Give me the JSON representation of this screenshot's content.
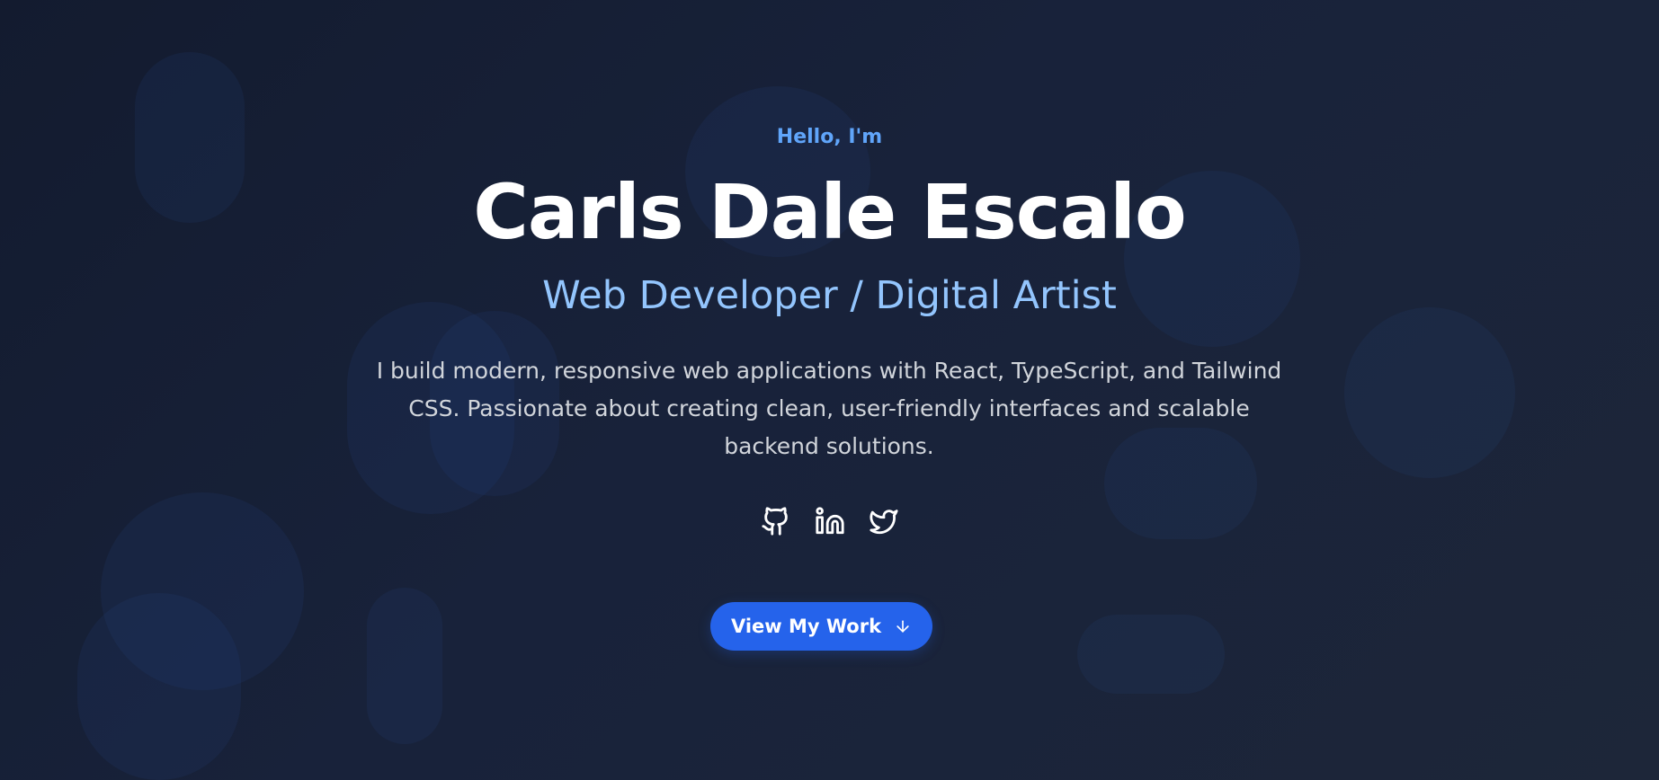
{
  "hero": {
    "greeting": "Hello, I'm",
    "name": "Carls Dale Escalo",
    "role": "Web Developer / Digital Artist",
    "bio": "I build modern, responsive web applications with React, TypeScript, and Tailwind CSS. Passionate about creating clean, user-friendly interfaces and scalable backend solutions."
  },
  "socials": [
    {
      "icon": "github-icon"
    },
    {
      "icon": "linkedin-icon"
    },
    {
      "icon": "twitter-icon"
    }
  ],
  "cta": {
    "label": "View My Work",
    "icon": "arrow-down-icon"
  },
  "colors": {
    "accent": "#60a5fa",
    "role_text": "#93c5fd",
    "button": "#2563eb",
    "background": "#131b2f"
  }
}
